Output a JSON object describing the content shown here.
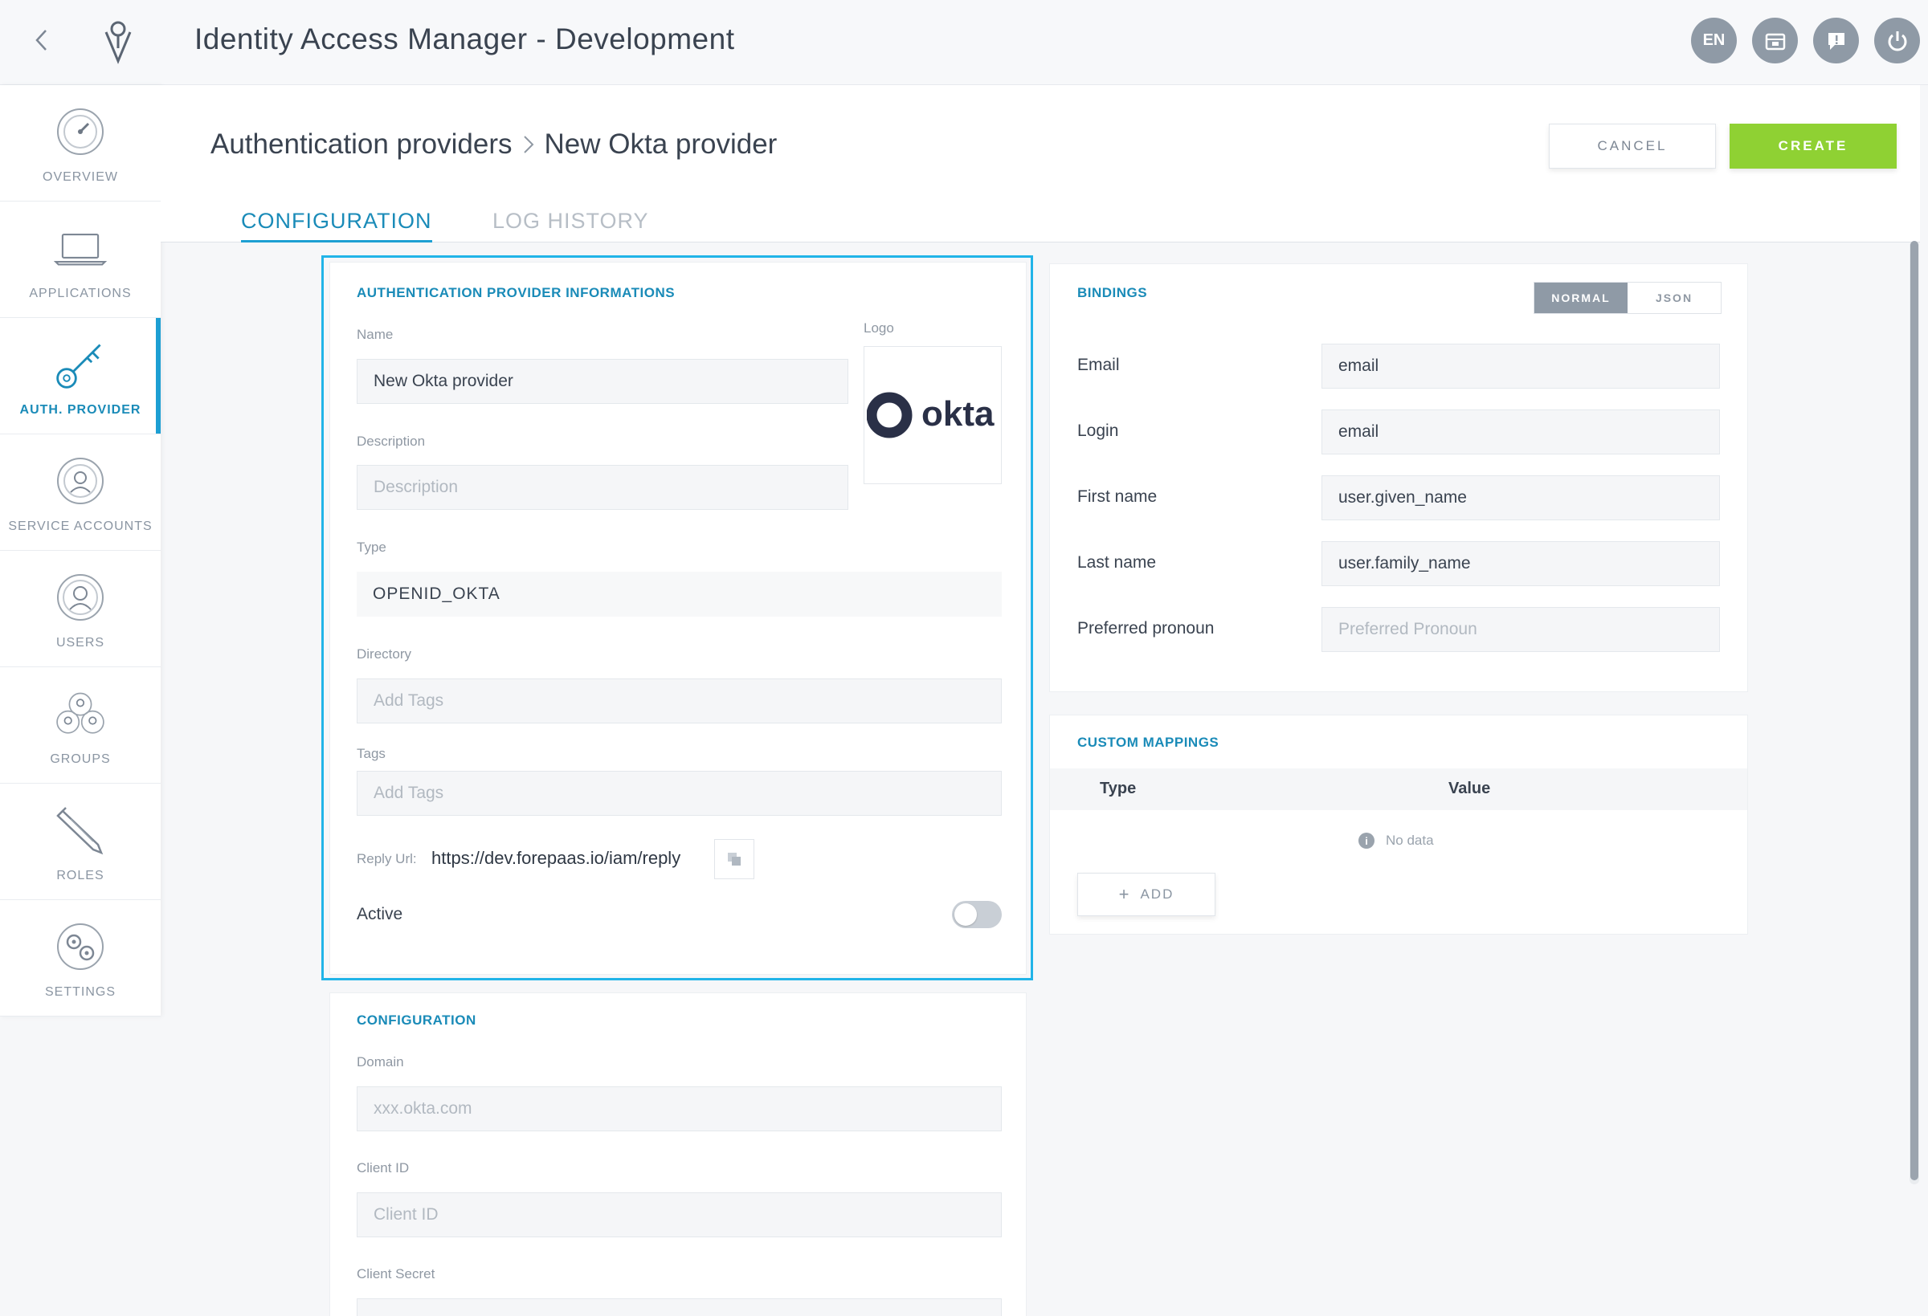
{
  "header": {
    "title": "Identity Access Manager - Development",
    "language": "EN"
  },
  "sidebar": {
    "items": [
      {
        "label": "OVERVIEW",
        "icon": "gauge-icon"
      },
      {
        "label": "APPLICATIONS",
        "icon": "laptop-icon"
      },
      {
        "label": "AUTH. PROVIDER",
        "icon": "key-icon"
      },
      {
        "label": "SERVICE ACCOUNTS",
        "icon": "service-account-icon"
      },
      {
        "label": "USERS",
        "icon": "user-icon"
      },
      {
        "label": "GROUPS",
        "icon": "group-icon"
      },
      {
        "label": "ROLES",
        "icon": "pencil-icon"
      },
      {
        "label": "SETTINGS",
        "icon": "gears-icon"
      }
    ],
    "active_item": "AUTH. PROVIDER"
  },
  "breadcrumb": {
    "parent": "Authentication providers",
    "current": "New Okta provider"
  },
  "actions": {
    "cancel": "CANCEL",
    "create": "CREATE"
  },
  "tabs": {
    "configuration": "CONFIGURATION",
    "log_history": "LOG HISTORY"
  },
  "provider_info": {
    "title": "AUTHENTICATION PROVIDER INFORMATIONS",
    "name_label": "Name",
    "name_value": "New Okta provider",
    "logo_label": "Logo",
    "logo_text": "okta",
    "description_label": "Description",
    "description_placeholder": "Description",
    "type_label": "Type",
    "type_value": "OPENID_OKTA",
    "directory_label": "Directory",
    "directory_placeholder": "Add Tags",
    "tags_label": "Tags",
    "tags_placeholder": "Add Tags",
    "reply_url_label": "Reply Url:",
    "reply_url_value": "https://dev.forepaas.io/iam/reply",
    "active_label": "Active",
    "active": false
  },
  "configuration": {
    "title": "CONFIGURATION",
    "domain_label": "Domain",
    "domain_placeholder": "xxx.okta.com",
    "client_id_label": "Client ID",
    "client_id_placeholder": "Client ID",
    "client_secret_label": "Client Secret"
  },
  "bindings": {
    "title": "BINDINGS",
    "mode_normal": "NORMAL",
    "mode_json": "JSON",
    "mode_selected": "NORMAL",
    "rows": [
      {
        "label": "Email",
        "value": "email",
        "placeholder": ""
      },
      {
        "label": "Login",
        "value": "email",
        "placeholder": ""
      },
      {
        "label": "First name",
        "value": "user.given_name",
        "placeholder": ""
      },
      {
        "label": "Last name",
        "value": "user.family_name",
        "placeholder": ""
      },
      {
        "label": "Preferred pronoun",
        "value": "",
        "placeholder": "Preferred Pronoun"
      }
    ]
  },
  "custom_mappings": {
    "title": "CUSTOM MAPPINGS",
    "columns": [
      "Type",
      "Value"
    ],
    "empty_text": "No data",
    "add_label": "ADD"
  },
  "colors": {
    "accent": "#1d9fd3",
    "create_green": "#8fd133",
    "highlight": "#21b4e8",
    "okta_navy": "#2a3047"
  }
}
